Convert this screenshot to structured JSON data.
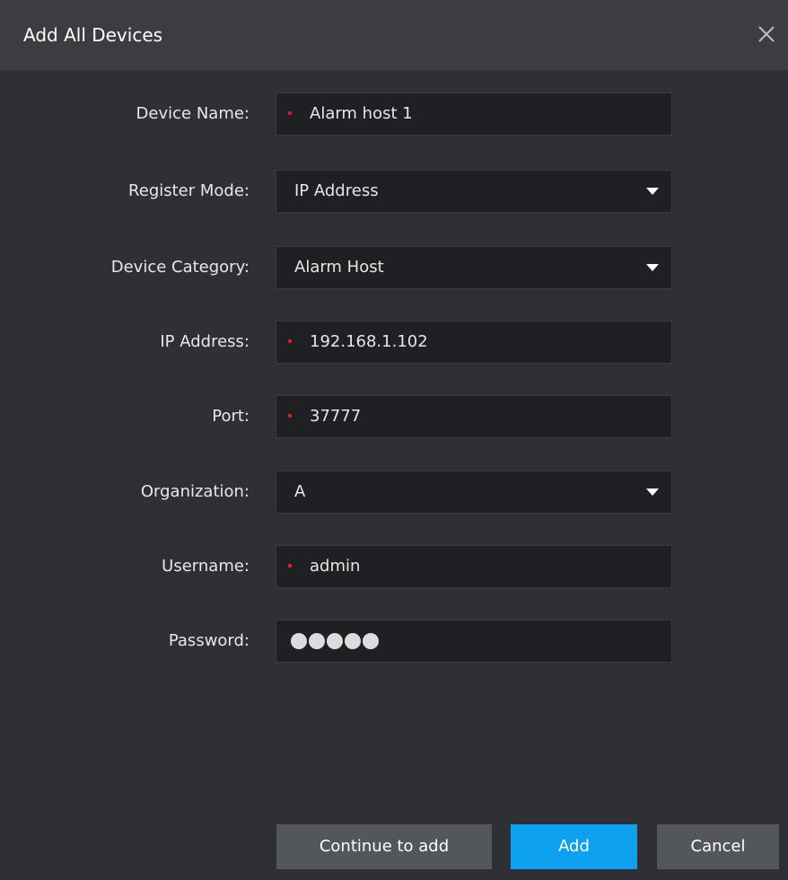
{
  "dialog": {
    "title": "Add All Devices"
  },
  "icons": {
    "close": "close-icon",
    "dropdown": "caret-down-icon"
  },
  "colors": {
    "background": "#2e3035",
    "titlebar": "#3b3d41",
    "field_bg": "#1f2023",
    "required_marker": "#e21e1e",
    "primary_button": "#0ea1ef",
    "secondary_button": "#53565b"
  },
  "form": {
    "device_name": {
      "label": "Device Name:",
      "value": "Alarm host 1"
    },
    "register_mode": {
      "label": "Register Mode:",
      "value": "IP Address"
    },
    "device_category": {
      "label": "Device Category:",
      "value": "Alarm Host"
    },
    "ip_address": {
      "label": "IP Address:",
      "value": "192.168.1.102"
    },
    "port": {
      "label": "Port:",
      "value": "37777"
    },
    "organization": {
      "label": "Organization:",
      "value": "A"
    },
    "username": {
      "label": "Username:",
      "value": "admin"
    },
    "password": {
      "label": "Password:",
      "mask": "●●●●●"
    }
  },
  "buttons": {
    "continue_label": "Continue to add",
    "add_label": "Add",
    "cancel_label": "Cancel"
  }
}
